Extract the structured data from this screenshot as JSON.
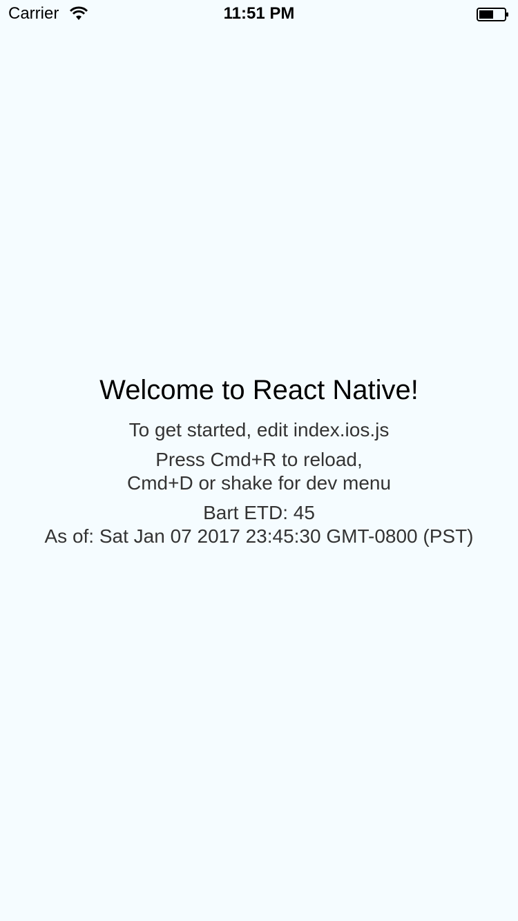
{
  "status_bar": {
    "carrier": "Carrier",
    "time": "11:51 PM",
    "wifi_icon": "wifi-icon",
    "battery_icon": "battery-icon"
  },
  "main": {
    "welcome": "Welcome to React Native!",
    "instructions": "To get started, edit index.ios.js",
    "reload_line1": "Press Cmd+R to reload,",
    "reload_line2": "Cmd+D or shake for dev menu",
    "bart_etd": "Bart ETD: 45",
    "as_of": "As of: Sat Jan 07 2017 23:45:30 GMT-0800 (PST)"
  },
  "colors": {
    "background": "#F5FCFF",
    "text": "#333333",
    "title": "#000000"
  }
}
